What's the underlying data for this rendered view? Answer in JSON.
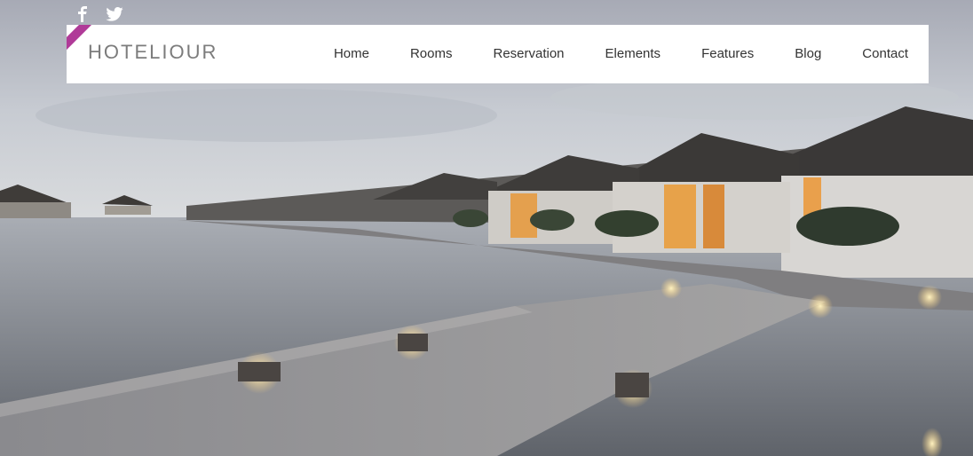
{
  "social": {
    "icons": [
      "facebook-icon",
      "twitter-icon"
    ]
  },
  "header": {
    "brand": "HOTELIOUR"
  },
  "nav": {
    "items": [
      "Home",
      "Rooms",
      "Reservation",
      "Elements",
      "Features",
      "Blog",
      "Contact"
    ]
  },
  "colors": {
    "accent": "#b03a98",
    "nav_bg": "#ffffff",
    "nav_text": "#333333",
    "brand_text": "#7c7c7c"
  }
}
